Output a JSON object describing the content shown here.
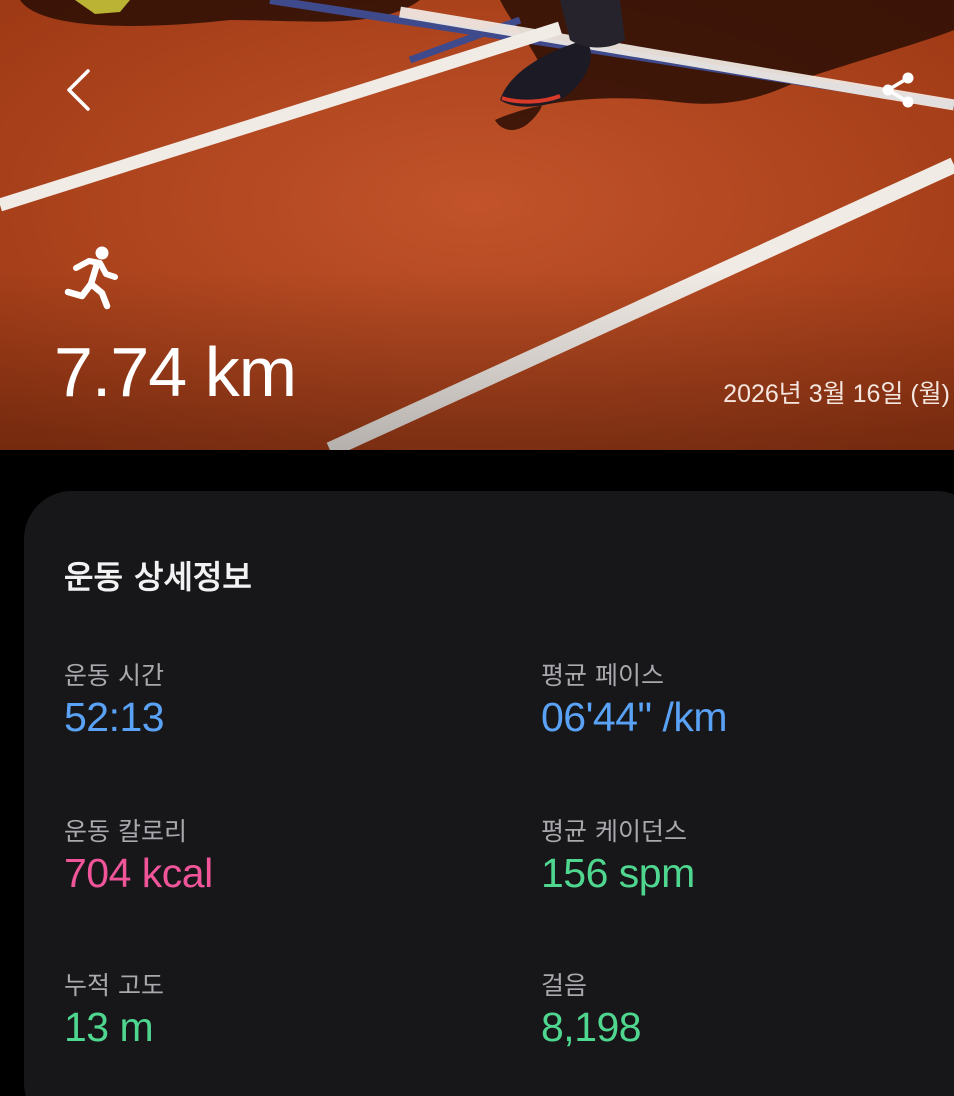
{
  "header": {
    "back_icon": "chevron-left-icon",
    "share_icon": "share-icon",
    "activity_icon": "running-person-icon",
    "distance": "7.74 km",
    "date": "2026년 3월 16일 (월)"
  },
  "details": {
    "title": "운동 상세정보",
    "stats": [
      {
        "label": "운동 시간",
        "value": "52:13",
        "color": "#5aa2f5"
      },
      {
        "label": "평균 페이스",
        "value": "06'44\" /km",
        "color": "#5aa2f5"
      },
      {
        "label": "운동 칼로리",
        "value": "704 kcal",
        "color": "#f0559a"
      },
      {
        "label": "평균 케이던스",
        "value": "156 spm",
        "color": "#4fd68f"
      },
      {
        "label": "누적 고도",
        "value": "13 m",
        "color": "#4fd68f"
      },
      {
        "label": "걸음",
        "value": "8,198",
        "color": "#4fd68f"
      }
    ]
  },
  "colors": {
    "track": "#b5461f",
    "card_background": "#17171a",
    "page_background": "#000000"
  }
}
